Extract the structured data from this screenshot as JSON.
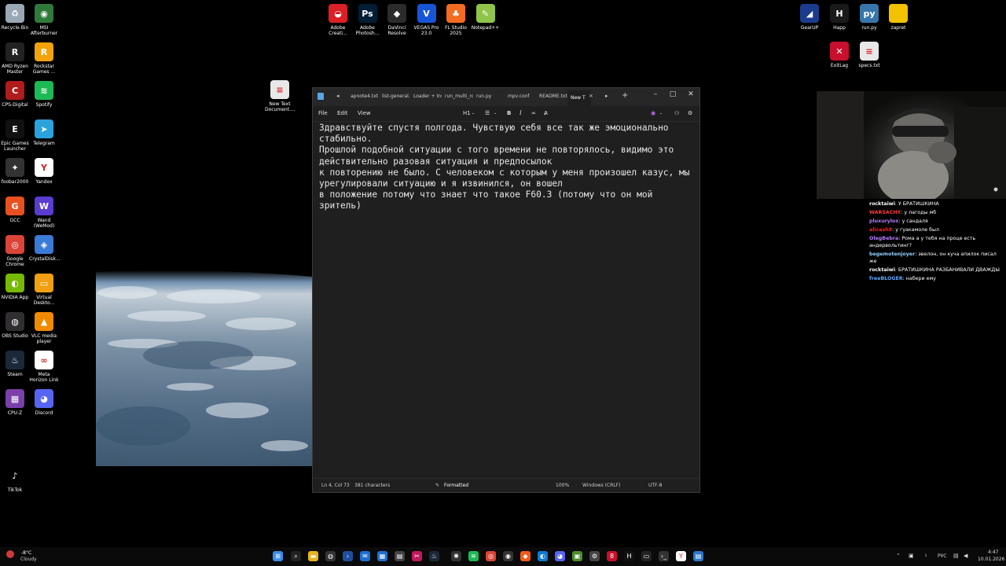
{
  "desktop": {
    "left_icons": [
      {
        "label": "Recycle Bin",
        "icon": "recycle-bin-icon",
        "color": "#9aa7b5",
        "glyph": "♻"
      },
      {
        "label": "MSI Afterburner",
        "icon": "msi-afterburner-icon",
        "color": "#2f7a3a",
        "glyph": "◉"
      },
      {
        "label": "AMD Ryzen Master",
        "icon": "amd-ryzen-icon",
        "color": "#222222",
        "glyph": "R"
      },
      {
        "label": "Rockstar Games ...",
        "icon": "rockstar-icon",
        "color": "#f2a20b",
        "glyph": "R"
      },
      {
        "label": "CPS-Digital",
        "icon": "cps-digital-icon",
        "color": "#b01b1b",
        "glyph": "C"
      },
      {
        "label": "Spotify",
        "icon": "spotify-icon",
        "color": "#1db954",
        "glyph": "≋"
      },
      {
        "label": "Epic Games Launcher",
        "icon": "epic-games-icon",
        "color": "#111111",
        "glyph": "E"
      },
      {
        "label": "Telegram",
        "icon": "telegram-icon",
        "color": "#2aa3dd",
        "glyph": "➤"
      },
      {
        "label": "foobar2000",
        "icon": "foobar-icon",
        "color": "#333333",
        "glyph": "✦"
      },
      {
        "label": "Yandex",
        "icon": "yandex-icon",
        "color": "#ffffff",
        "glyph": "Y"
      },
      {
        "label": "GCC",
        "icon": "gcc-icon",
        "color": "#e8501f",
        "glyph": "G"
      },
      {
        "label": "Wand (WeMod)",
        "icon": "wand-icon",
        "color": "#5a3ccf",
        "glyph": "W"
      },
      {
        "label": "Google Chrome",
        "icon": "chrome-icon",
        "color": "#db4437",
        "glyph": "◎"
      },
      {
        "label": "CrystalDisk...",
        "icon": "crystaldisk-icon",
        "color": "#3a7bd5",
        "glyph": "◈"
      },
      {
        "label": "NVIDIA App",
        "icon": "nvidia-icon",
        "color": "#76b900",
        "glyph": "◐"
      },
      {
        "label": "Virtual Deskto...",
        "icon": "virtual-desktop-icon",
        "color": "#f0a010",
        "glyph": "▭"
      },
      {
        "label": "OBS Studio",
        "icon": "obs-icon",
        "color": "#302e31",
        "glyph": "◍"
      },
      {
        "label": "VLC media player",
        "icon": "vlc-icon",
        "color": "#f08a00",
        "glyph": "▲"
      },
      {
        "label": "Steam",
        "icon": "steam-icon",
        "color": "#1b2838",
        "glyph": "♨"
      },
      {
        "label": "Meta Horizon Link",
        "icon": "meta-icon",
        "color": "#ffffff",
        "glyph": "∞"
      },
      {
        "label": "CPU-Z",
        "icon": "cpu-z-icon",
        "color": "#7a3fa8",
        "glyph": "▦"
      },
      {
        "label": "Discord",
        "icon": "discord-icon",
        "color": "#5865f2",
        "glyph": "◕"
      },
      {
        "label": "TikTok",
        "icon": "tiktok-icon",
        "color": "#000000",
        "glyph": "♪"
      }
    ],
    "top_icons": [
      {
        "label": "Adobe Creati...",
        "icon": "adobe-cc-icon",
        "color": "#da1f26",
        "glyph": "◒"
      },
      {
        "label": "Adobe Photosh...",
        "icon": "photoshop-icon",
        "color": "#001e36",
        "glyph": "Ps"
      },
      {
        "label": "DaVinci Resolve",
        "icon": "davinci-icon",
        "color": "#2b2b2b",
        "glyph": "◆"
      },
      {
        "label": "VEGAS Pro 23.0",
        "icon": "vegas-icon",
        "color": "#1656d6",
        "glyph": "V"
      },
      {
        "label": "FL Studio 2025",
        "icon": "fl-studio-icon",
        "color": "#f26c22",
        "glyph": "♣"
      },
      {
        "label": "Notepad++",
        "icon": "notepadpp-icon",
        "color": "#8fc34a",
        "glyph": "✎"
      }
    ],
    "mid_icons": [
      {
        "label": "New Text Document....",
        "icon": "text-file-icon",
        "color": "#e8e8e8",
        "glyph": "≡"
      }
    ],
    "right_icons": [
      {
        "label": "GearUP",
        "icon": "gearup-icon",
        "color": "#1a3c8c",
        "glyph": "◢"
      },
      {
        "label": "Happ",
        "icon": "happ-icon",
        "color": "#1a1a1a",
        "glyph": "H"
      },
      {
        "label": "run.py",
        "icon": "python-file-icon",
        "color": "#3776ab",
        "glyph": "py"
      },
      {
        "label": "zapret",
        "icon": "folder-icon",
        "color": "#f2c200",
        "glyph": ""
      },
      {
        "label": "ExitLag",
        "icon": "exitlag-icon",
        "color": "#c8102e",
        "glyph": "✕"
      },
      {
        "label": "specs.txt",
        "icon": "text-file-icon",
        "color": "#e8e8e8",
        "glyph": "≡"
      }
    ]
  },
  "notepad": {
    "tabs": [
      "apnote4.txt",
      "list-general.t",
      "Loader + Ins",
      "run_multi_ro",
      "run.py",
      "mpv.conf",
      "README.txt",
      "New T"
    ],
    "menu": [
      "File",
      "Edit",
      "View"
    ],
    "toolbar": {
      "heading": "H1"
    },
    "content": "Здравствуйте спустя полгода. Чувствую себя все так же эмоционально стабильно.\nПрошлой подобной ситуации с того времени не повторялось, видимо это действительно разовая ситуация и предпосылок\nк повторению не было. С человеком с которым у меня произошел казус, мы урегулировали ситуацию и я извинился, он вошел\nв положение потому что знает что такое F60.3 (потому что он мой зритель)",
    "status": {
      "position": "Ln 4, Col 73",
      "chars": "381 characters",
      "mode": "Formatted",
      "zoom": "100%",
      "eol": "Windows (CRLF)",
      "encoding": "UTF-8"
    }
  },
  "chat": [
    {
      "user": "rocktaiwi",
      "color": "#ffffff",
      "text": "У БРАТИШКИНА"
    },
    {
      "user": "WARSACHY",
      "color": "#ff3b3b",
      "text": "у лагоды мб"
    },
    {
      "user": "pluxurylox",
      "color": "#b57bff",
      "text": "у сандаля"
    },
    {
      "user": "alicash8",
      "color": "#ff2020",
      "text": "у гуакамоле был"
    },
    {
      "user": "OlegBebra",
      "color": "#b57bff",
      "text": "Рома а у тебя на проце есть андервольтинг?"
    },
    {
      "user": "begemotenjoyer",
      "color": "#8fd1ff",
      "text": "эвелон, он куча апилок писал же"
    },
    {
      "user": "rocktaiwi",
      "color": "#ffffff",
      "text": "БРАТИШКИНА РАЗБАНИВАЛИ ДВАЖДЫ"
    },
    {
      "user": "freeBLOGER",
      "color": "#5fa8ff",
      "text": "набери ему"
    }
  ],
  "taskbar": {
    "weather_temp": "-8°C",
    "weather_desc": "Cloudy",
    "lang": "РУС",
    "time": "4:47",
    "date": "10.01.2026"
  }
}
